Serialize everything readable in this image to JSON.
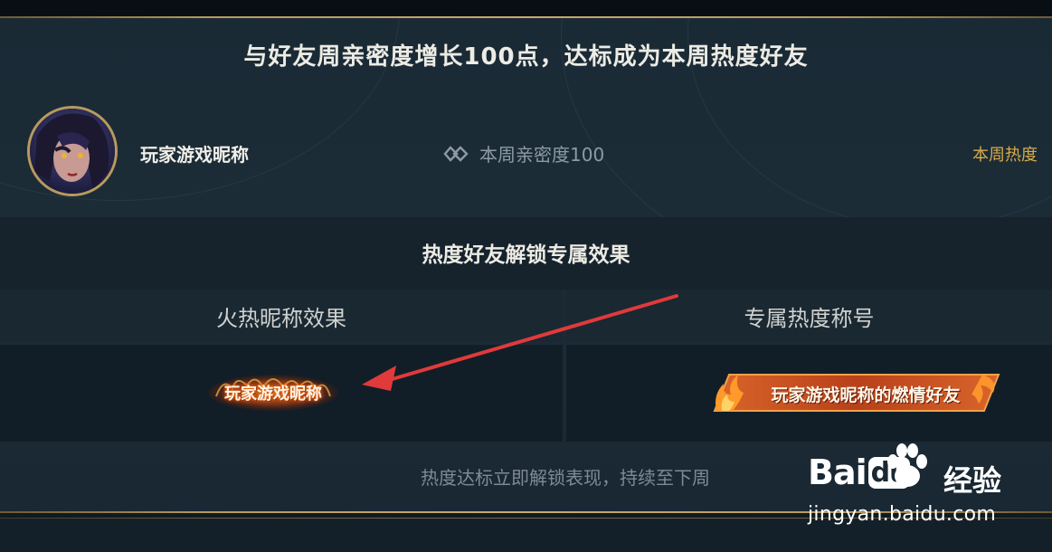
{
  "headline": "与好友周亲密度增长100点，达标成为本周热度好友",
  "player": {
    "name": "玩家游戏昵称",
    "intimacy": "本周亲密度100",
    "hot_label": "本周热度"
  },
  "unlock": {
    "title": "热度好友解锁专属效果"
  },
  "effects": {
    "nickname_header": "火热昵称效果",
    "title_header": "专属热度称号",
    "nickname_sample": "玩家游戏昵称",
    "title_sample": "玩家游戏昵称的燃情好友"
  },
  "footer_note": "热度达标立即解锁表现，持续至下周",
  "colors": {
    "gold": "#c9a96a",
    "hot": "#d8ab4a",
    "arrow": "#e03a3a",
    "badge": "#b8411a"
  },
  "watermark": {
    "logo_a": "Bai",
    "logo_b": "du",
    "logo_c": "经验",
    "url": "jingyan.baidu.com"
  }
}
